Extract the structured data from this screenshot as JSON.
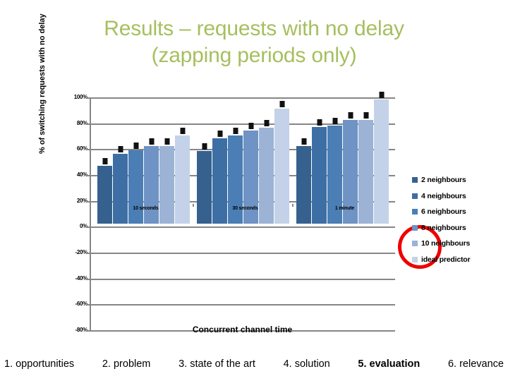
{
  "slide": {
    "title_line1": "Results – requests with no delay",
    "title_line2": "(zapping periods only)",
    "title_color": "#a6bf5e"
  },
  "chart_data": {
    "type": "bar",
    "title": "Results – requests with no delay (zapping periods only)",
    "xlabel": "Concurrent channel time",
    "ylabel": "% of switching requests with no delay",
    "categories": [
      "10 seconds",
      "30 seconds",
      "1 minute"
    ],
    "ylim": [
      -80,
      100
    ],
    "ytick_labels": [
      "100%",
      "80%",
      "60%",
      "40%",
      "20%",
      "0%",
      "-20%",
      "-40%",
      "-60%",
      "-80%"
    ],
    "ytick_values": [
      100,
      80,
      60,
      40,
      20,
      0,
      -20,
      -40,
      -60,
      -80
    ],
    "grid": true,
    "legend_position": "right",
    "error_bars": true,
    "series": [
      {
        "name": "2 neighbours",
        "color": "#36618f",
        "values": [
          45,
          56,
          60
        ]
      },
      {
        "name": "4 neighbours",
        "color": "#3d6fa5",
        "values": [
          54,
          66,
          75
        ]
      },
      {
        "name": "6 neighbours",
        "color": "#4a7eb5",
        "values": [
          57,
          68,
          76
        ]
      },
      {
        "name": "8 neighbours",
        "color": "#6e93c4",
        "values": [
          60,
          72,
          80
        ]
      },
      {
        "name": "10 neighbours",
        "color": "#9cb3d6",
        "values": [
          60,
          74,
          80
        ]
      },
      {
        "name": "ideal predictor",
        "color": "#c3d2e8",
        "values": [
          68,
          89,
          96
        ]
      }
    ],
    "annotations": [
      {
        "type": "ellipse",
        "color": "#ee0000",
        "target": "1 minute group, 4 and 6 neighbours bars"
      }
    ]
  },
  "footer": {
    "items": [
      {
        "label": "1. opportunities",
        "active": false
      },
      {
        "label": "2. problem",
        "active": false
      },
      {
        "label": "3. state of the art",
        "active": false
      },
      {
        "label": "4. solution",
        "active": false
      },
      {
        "label": "5. evaluation",
        "active": true
      },
      {
        "label": "6. relevance",
        "active": false
      }
    ]
  }
}
